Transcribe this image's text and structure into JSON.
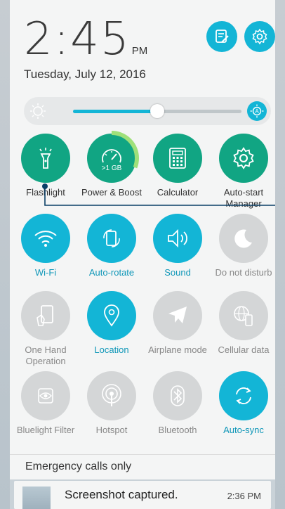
{
  "status": {
    "time": "2:45",
    "ampm": "PM",
    "date": "Tuesday, July 12, 2016"
  },
  "header_buttons": [
    {
      "name": "edit-icon"
    },
    {
      "name": "gear-icon"
    }
  ],
  "brightness": {
    "level_fraction": 0.5
  },
  "accent_color": "#13b5d6",
  "shortcuts": [
    {
      "label": "Flashlight",
      "icon": "flashlight-icon",
      "state": "green"
    },
    {
      "label": "Power & Boost",
      "icon": "boost-gauge-icon",
      "state": "green",
      "ram": ">1 GB"
    },
    {
      "label": "Calculator",
      "icon": "calculator-icon",
      "state": "green"
    },
    {
      "label": "Auto-start Manager",
      "icon": "gear-icon",
      "state": "green"
    }
  ],
  "toggles": [
    {
      "label": "Wi-Fi",
      "icon": "wifi-icon",
      "state": "blue"
    },
    {
      "label": "Auto-rotate",
      "icon": "auto-rotate-icon",
      "state": "blue"
    },
    {
      "label": "Sound",
      "icon": "speaker-icon",
      "state": "blue"
    },
    {
      "label": "Do not disturb",
      "icon": "moon-icon",
      "state": "grey"
    },
    {
      "label": "One Hand Operation",
      "icon": "one-hand-icon",
      "state": "grey"
    },
    {
      "label": "Location",
      "icon": "location-pin-icon",
      "state": "blue"
    },
    {
      "label": "Airplane mode",
      "icon": "airplane-icon",
      "state": "grey"
    },
    {
      "label": "Cellular data",
      "icon": "globe-phone-icon",
      "state": "grey"
    },
    {
      "label": "Bluelight Filter",
      "icon": "eye-icon",
      "state": "grey"
    },
    {
      "label": "Hotspot",
      "icon": "hotspot-icon",
      "state": "grey"
    },
    {
      "label": "Bluetooth",
      "icon": "bluetooth-icon",
      "state": "grey"
    },
    {
      "label": "Auto-sync",
      "icon": "sync-icon",
      "state": "blue"
    }
  ],
  "emergency": "Emergency calls only",
  "notification": {
    "title": "Screenshot captured.",
    "time": "2:36 PM"
  }
}
